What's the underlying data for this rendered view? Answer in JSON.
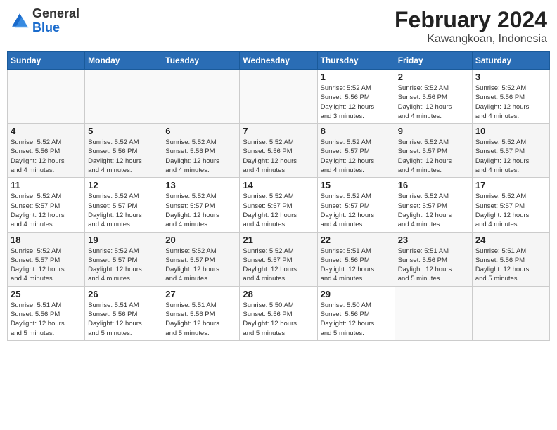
{
  "header": {
    "logo": {
      "general": "General",
      "blue": "Blue"
    },
    "title": "February 2024",
    "location": "Kawangkoan, Indonesia"
  },
  "weekdays": [
    "Sunday",
    "Monday",
    "Tuesday",
    "Wednesday",
    "Thursday",
    "Friday",
    "Saturday"
  ],
  "rows": [
    {
      "cells": [
        {
          "day": "",
          "empty": true
        },
        {
          "day": "",
          "empty": true
        },
        {
          "day": "",
          "empty": true
        },
        {
          "day": "",
          "empty": true
        },
        {
          "day": "1",
          "info": "Sunrise: 5:52 AM\nSunset: 5:56 PM\nDaylight: 12 hours\nand 3 minutes."
        },
        {
          "day": "2",
          "info": "Sunrise: 5:52 AM\nSunset: 5:56 PM\nDaylight: 12 hours\nand 4 minutes."
        },
        {
          "day": "3",
          "info": "Sunrise: 5:52 AM\nSunset: 5:56 PM\nDaylight: 12 hours\nand 4 minutes."
        }
      ]
    },
    {
      "cells": [
        {
          "day": "4",
          "info": "Sunrise: 5:52 AM\nSunset: 5:56 PM\nDaylight: 12 hours\nand 4 minutes."
        },
        {
          "day": "5",
          "info": "Sunrise: 5:52 AM\nSunset: 5:56 PM\nDaylight: 12 hours\nand 4 minutes."
        },
        {
          "day": "6",
          "info": "Sunrise: 5:52 AM\nSunset: 5:56 PM\nDaylight: 12 hours\nand 4 minutes."
        },
        {
          "day": "7",
          "info": "Sunrise: 5:52 AM\nSunset: 5:56 PM\nDaylight: 12 hours\nand 4 minutes."
        },
        {
          "day": "8",
          "info": "Sunrise: 5:52 AM\nSunset: 5:57 PM\nDaylight: 12 hours\nand 4 minutes."
        },
        {
          "day": "9",
          "info": "Sunrise: 5:52 AM\nSunset: 5:57 PM\nDaylight: 12 hours\nand 4 minutes."
        },
        {
          "day": "10",
          "info": "Sunrise: 5:52 AM\nSunset: 5:57 PM\nDaylight: 12 hours\nand 4 minutes."
        }
      ]
    },
    {
      "cells": [
        {
          "day": "11",
          "info": "Sunrise: 5:52 AM\nSunset: 5:57 PM\nDaylight: 12 hours\nand 4 minutes."
        },
        {
          "day": "12",
          "info": "Sunrise: 5:52 AM\nSunset: 5:57 PM\nDaylight: 12 hours\nand 4 minutes."
        },
        {
          "day": "13",
          "info": "Sunrise: 5:52 AM\nSunset: 5:57 PM\nDaylight: 12 hours\nand 4 minutes."
        },
        {
          "day": "14",
          "info": "Sunrise: 5:52 AM\nSunset: 5:57 PM\nDaylight: 12 hours\nand 4 minutes."
        },
        {
          "day": "15",
          "info": "Sunrise: 5:52 AM\nSunset: 5:57 PM\nDaylight: 12 hours\nand 4 minutes."
        },
        {
          "day": "16",
          "info": "Sunrise: 5:52 AM\nSunset: 5:57 PM\nDaylight: 12 hours\nand 4 minutes."
        },
        {
          "day": "17",
          "info": "Sunrise: 5:52 AM\nSunset: 5:57 PM\nDaylight: 12 hours\nand 4 minutes."
        }
      ]
    },
    {
      "cells": [
        {
          "day": "18",
          "info": "Sunrise: 5:52 AM\nSunset: 5:57 PM\nDaylight: 12 hours\nand 4 minutes."
        },
        {
          "day": "19",
          "info": "Sunrise: 5:52 AM\nSunset: 5:57 PM\nDaylight: 12 hours\nand 4 minutes."
        },
        {
          "day": "20",
          "info": "Sunrise: 5:52 AM\nSunset: 5:57 PM\nDaylight: 12 hours\nand 4 minutes."
        },
        {
          "day": "21",
          "info": "Sunrise: 5:52 AM\nSunset: 5:57 PM\nDaylight: 12 hours\nand 4 minutes."
        },
        {
          "day": "22",
          "info": "Sunrise: 5:51 AM\nSunset: 5:56 PM\nDaylight: 12 hours\nand 4 minutes."
        },
        {
          "day": "23",
          "info": "Sunrise: 5:51 AM\nSunset: 5:56 PM\nDaylight: 12 hours\nand 5 minutes."
        },
        {
          "day": "24",
          "info": "Sunrise: 5:51 AM\nSunset: 5:56 PM\nDaylight: 12 hours\nand 5 minutes."
        }
      ]
    },
    {
      "cells": [
        {
          "day": "25",
          "info": "Sunrise: 5:51 AM\nSunset: 5:56 PM\nDaylight: 12 hours\nand 5 minutes."
        },
        {
          "day": "26",
          "info": "Sunrise: 5:51 AM\nSunset: 5:56 PM\nDaylight: 12 hours\nand 5 minutes."
        },
        {
          "day": "27",
          "info": "Sunrise: 5:51 AM\nSunset: 5:56 PM\nDaylight: 12 hours\nand 5 minutes."
        },
        {
          "day": "28",
          "info": "Sunrise: 5:50 AM\nSunset: 5:56 PM\nDaylight: 12 hours\nand 5 minutes."
        },
        {
          "day": "29",
          "info": "Sunrise: 5:50 AM\nSunset: 5:56 PM\nDaylight: 12 hours\nand 5 minutes."
        },
        {
          "day": "",
          "empty": true
        },
        {
          "day": "",
          "empty": true
        }
      ]
    }
  ]
}
